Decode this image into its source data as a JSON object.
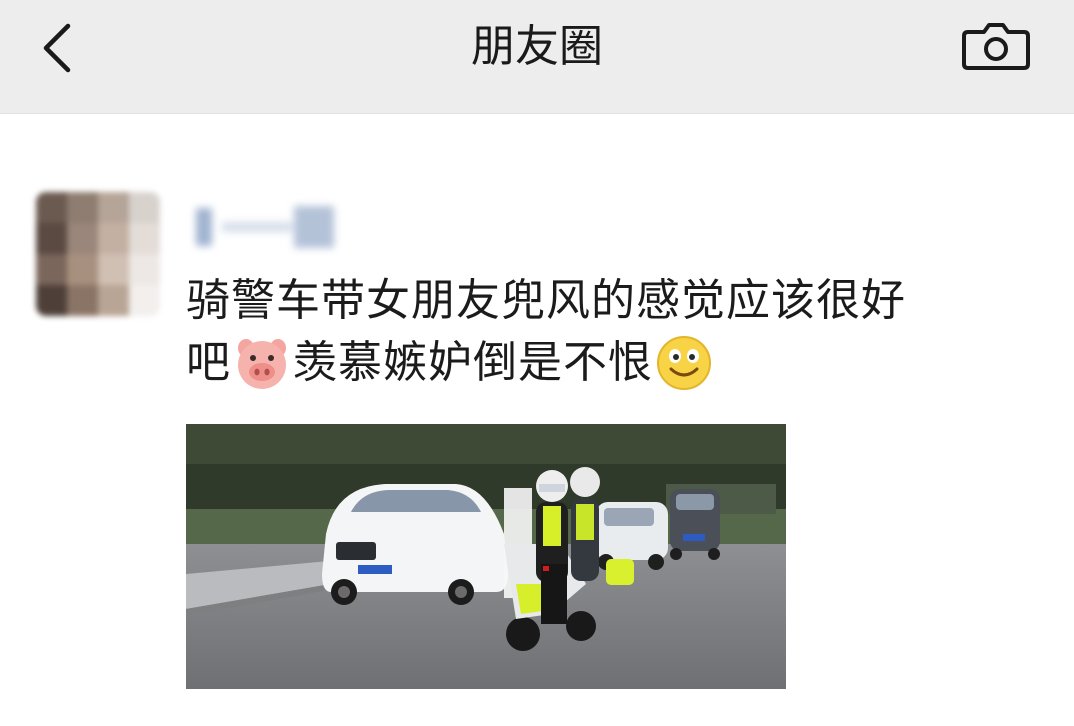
{
  "header": {
    "title": "朋友圈",
    "back_icon": "back-chevron-icon",
    "camera_icon": "camera-icon",
    "background": "#ededed"
  },
  "post": {
    "text_line1": "骑警车带女朋友兜风的感觉应该很好",
    "text_line2_before": "吧",
    "emoji_1": "pig-face-emoji",
    "text_line2_after": "羡慕嫉妒倒是不恨",
    "emoji_2": "smile-emoji",
    "image": {
      "plate_text": "",
      "description_icon": "police-motorcycle-photo"
    }
  }
}
